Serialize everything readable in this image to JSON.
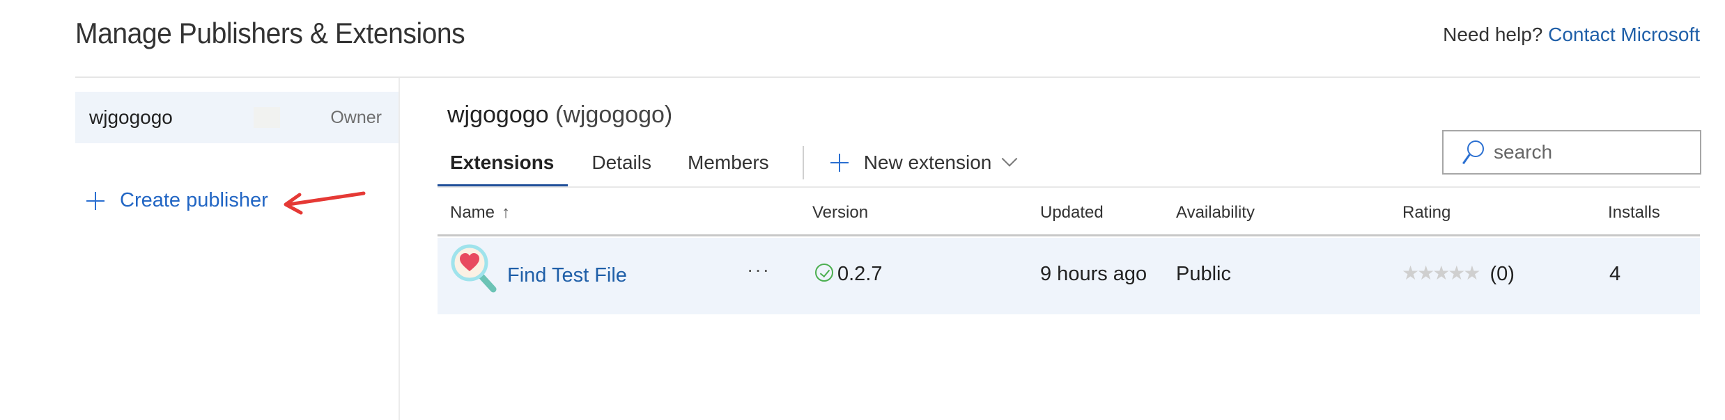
{
  "page": {
    "title": "Manage Publishers & Extensions",
    "help_prefix": "Need help?",
    "help_link": "Contact Microsoft"
  },
  "sidebar": {
    "publishers": [
      {
        "name": "wjgogogo",
        "role": "Owner",
        "selected": true
      }
    ],
    "create_publisher_label": "Create publisher"
  },
  "publisher": {
    "display_name": "wjgogogo",
    "id_text": "(wjgogogo)"
  },
  "tabs": [
    {
      "label": "Extensions",
      "active": true
    },
    {
      "label": "Details",
      "active": false
    },
    {
      "label": "Members",
      "active": false
    }
  ],
  "toolbar": {
    "new_extension_label": "New extension"
  },
  "search": {
    "placeholder": "search",
    "value": ""
  },
  "table": {
    "columns": [
      "Name",
      "Version",
      "Updated",
      "Availability",
      "Rating",
      "Installs"
    ],
    "sort": {
      "column": "Name",
      "direction": "ascending",
      "indicator": "↑"
    },
    "rows": [
      {
        "icon": "magnifier-heart-icon",
        "name": "Find Test File",
        "more": "···",
        "version_status": "verified",
        "version": "0.2.7",
        "updated": "9 hours ago",
        "availability": "Public",
        "rating_stars": 0,
        "rating_max": 5,
        "rating_count": "(0)",
        "installs": "4"
      }
    ]
  },
  "colors": {
    "link": "#1f5fa8",
    "accent": "#1f4f99",
    "selected_row_bg": "#eff4fb",
    "success": "#4caf50",
    "annotation_arrow": "#e53935"
  }
}
